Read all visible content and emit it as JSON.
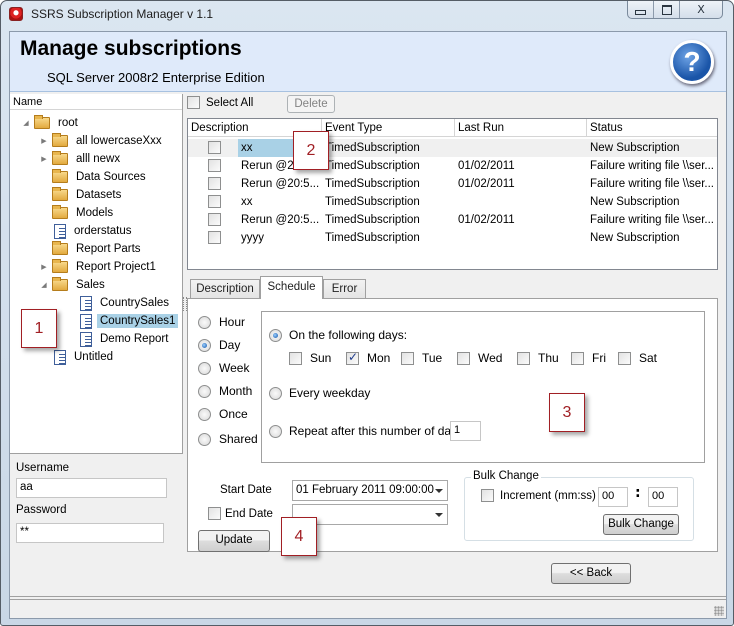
{
  "window": {
    "title": "SSRS Subscription Manager v 1.1",
    "caption_buttons": {
      "minimize": "minimize",
      "maximize": "maximize",
      "close": "X"
    }
  },
  "header": {
    "title": "Manage subscriptions",
    "subtitle": "SQL Server 2008r2 Enterprise Edition",
    "help_icon_glyph": "?"
  },
  "tree": {
    "column_header": "Name",
    "items": [
      {
        "label": "root",
        "type": "folder",
        "expander": "expanded",
        "level": 0
      },
      {
        "label": "all lowercaseXxx",
        "type": "folder",
        "expander": "collapsed",
        "level": 1
      },
      {
        "label": "alll newx",
        "type": "folder",
        "expander": "collapsed",
        "level": 1
      },
      {
        "label": "Data Sources",
        "type": "folder",
        "expander": "none",
        "level": 1
      },
      {
        "label": "Datasets",
        "type": "folder",
        "expander": "none",
        "level": 1
      },
      {
        "label": "Models",
        "type": "folder",
        "expander": "none",
        "level": 1
      },
      {
        "label": "orderstatus",
        "type": "report",
        "expander": "none",
        "level": 1
      },
      {
        "label": "Report Parts",
        "type": "folder",
        "expander": "none",
        "level": 1
      },
      {
        "label": "Report Project1",
        "type": "folder",
        "expander": "collapsed",
        "level": 1
      },
      {
        "label": "Sales",
        "type": "folder",
        "expander": "expanded",
        "level": 1
      },
      {
        "label": "CountrySales",
        "type": "report",
        "expander": "none",
        "level": 2
      },
      {
        "label": "CountrySales1",
        "type": "report",
        "expander": "none",
        "level": 2,
        "selected": true
      },
      {
        "label": "Demo Report",
        "type": "report",
        "expander": "none",
        "level": 2
      },
      {
        "label": "Untitled",
        "type": "report",
        "expander": "none",
        "level": 1
      }
    ]
  },
  "credentials": {
    "username_label": "Username",
    "username_value": "aa",
    "password_label": "Password",
    "password_value": "**"
  },
  "toolbar": {
    "select_all_label": "Select All",
    "select_all_checked": false,
    "delete_label": "Delete",
    "delete_enabled": false
  },
  "subscriptions": {
    "columns": [
      "Description",
      "Event Type",
      "Last Run",
      "Status"
    ],
    "rows": [
      {
        "checked": false,
        "description": "xx",
        "event_type": "TimedSubscription",
        "last_run": "",
        "status": "New Subscription",
        "selected": true
      },
      {
        "checked": false,
        "description": "Rerun @20:5...",
        "event_type": "TimedSubscription",
        "last_run": "01/02/2011",
        "status": "Failure writing file \\\\ser..."
      },
      {
        "checked": false,
        "description": "Rerun @20:5...",
        "event_type": "TimedSubscription",
        "last_run": "01/02/2011",
        "status": "Failure writing file \\\\ser..."
      },
      {
        "checked": false,
        "description": "xx",
        "event_type": "TimedSubscription",
        "last_run": "",
        "status": "New Subscription"
      },
      {
        "checked": false,
        "description": "Rerun @20:5...",
        "event_type": "TimedSubscription",
        "last_run": "01/02/2011",
        "status": "Failure writing file \\\\ser..."
      },
      {
        "checked": false,
        "description": "yyyy",
        "event_type": "TimedSubscription",
        "last_run": "",
        "status": "New Subscription"
      }
    ]
  },
  "tabs": [
    {
      "label": "Description",
      "active": false
    },
    {
      "label": "Schedule",
      "active": true
    },
    {
      "label": "Error",
      "active": false
    }
  ],
  "schedule": {
    "frequency_options": [
      {
        "label": "Hour",
        "checked": false
      },
      {
        "label": "Day",
        "checked": true
      },
      {
        "label": "Week",
        "checked": false
      },
      {
        "label": "Month",
        "checked": false
      },
      {
        "label": "Once",
        "checked": false
      },
      {
        "label": "Shared",
        "checked": false
      }
    ],
    "on_following_days_label": "On the following days:",
    "on_following_days_checked": true,
    "days": [
      {
        "label": "Sun",
        "checked": false
      },
      {
        "label": "Mon",
        "checked": true
      },
      {
        "label": "Tue",
        "checked": false
      },
      {
        "label": "Wed",
        "checked": false
      },
      {
        "label": "Thu",
        "checked": false
      },
      {
        "label": "Fri",
        "checked": false
      },
      {
        "label": "Sat",
        "checked": false
      }
    ],
    "every_weekday_label": "Every weekday",
    "every_weekday_checked": false,
    "repeat_label": "Repeat after this number of days",
    "repeat_checked": false,
    "repeat_value": "1",
    "start_date_label": "Start Date",
    "start_date_value": "01 February 2011 09:00:00",
    "end_date_label": "End Date",
    "end_date_checked": false,
    "end_date_value": "",
    "update_label": "Update"
  },
  "bulk_change": {
    "title": "Bulk Change",
    "increment_label": "Increment (mm:ss)",
    "increment_checked": false,
    "minutes": "00",
    "separator": ":",
    "seconds": "00",
    "button_label": "Bulk Change"
  },
  "navigation": {
    "back_label": "<< Back"
  },
  "callouts": [
    "1",
    "2",
    "3",
    "4"
  ],
  "colors": {
    "selection": "#a9d1e6",
    "header_bg": "#dfeafa",
    "callout_border": "#a11f24"
  }
}
